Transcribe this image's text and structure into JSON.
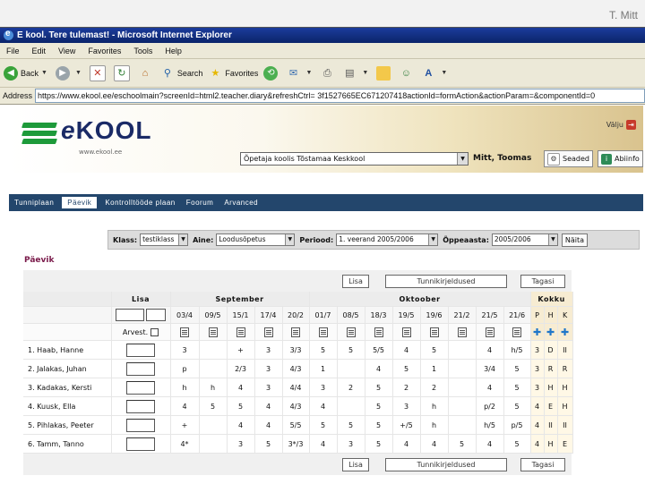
{
  "slide": {
    "author": "T. Mitt"
  },
  "window": {
    "title": "E kool. Tere tulemast! - Microsoft Internet Explorer"
  },
  "menu": [
    "File",
    "Edit",
    "View",
    "Favorites",
    "Tools",
    "Help"
  ],
  "toolbar": {
    "back": "Back",
    "search": "Search",
    "favorites": "Favorites"
  },
  "address": {
    "label": "Address",
    "url": "https://www.ekool.ee/eschoolmain?screenId=html2.teacher.diary&refreshCtrl= 3f1527665EC671207418actionId=formAction&actionParam=&componentId=0"
  },
  "header": {
    "logo_text_e": "e",
    "logo_text_rest": "KOOL",
    "logo_sub": "www.ekool.ee",
    "logout": "Välju",
    "school_select": "Õpetaja koolis Tõstamaa Keskkool",
    "user": "Mitt, Toomas",
    "settings_btn": "Seaded",
    "help_btn": "Abiinfo"
  },
  "nav": [
    "Tunniplaan",
    "Päevik",
    "Kontrolltööde plaan",
    "Foorum",
    "Arvanced"
  ],
  "nav_active": "Päevik",
  "filters": {
    "klass_label": "Klass:",
    "klass_value": "testiklass",
    "aine_label": "Aine:",
    "aine_value": "Loodusõpetus",
    "periood_label": "Periood:",
    "periood_value": "1. veerand 2005/2006",
    "oppeaasta_label": "Õppeaasta:",
    "oppeaasta_value": "2005/2006",
    "show_btn": "Näita"
  },
  "section_title": "Päevik",
  "grid": {
    "btn_lisa": "Lisa",
    "btn_tunnikirjeldused": "Tunnikirjeldused",
    "btn_tagasi": "Tagasi",
    "hdr_lisa": "Lisa",
    "hdr_september": "September",
    "hdr_oktoober": "Oktoober",
    "hdr_kokku": "Kokku",
    "dates": [
      "03/4",
      "09/5",
      "15/1",
      "17/4",
      "20/2",
      "01/7",
      "08/5",
      "18/3",
      "19/5",
      "19/6",
      "21/2",
      "21/5",
      "21/6"
    ],
    "kokku_cols": [
      "P",
      "H",
      "K"
    ],
    "arvest_label": "Arvest.",
    "students": [
      {
        "name": "1. Haab, Hanne",
        "marks": [
          "3",
          "",
          "+",
          "3",
          "3/3",
          "5",
          "5",
          "5/5",
          "4",
          "5",
          "",
          "4",
          "h/5"
        ],
        "kokku": [
          "3",
          "D",
          "II"
        ]
      },
      {
        "name": "2. Jalakas, Juhan",
        "marks": [
          "p",
          "",
          "2/3",
          "3",
          "4/3",
          "1",
          "",
          "4",
          "5",
          "1",
          "",
          "3/4",
          "5"
        ],
        "kokku": [
          "3",
          "R",
          "R"
        ]
      },
      {
        "name": "3. Kadakas, Kersti",
        "marks": [
          "h",
          "h",
          "4",
          "3",
          "4/4",
          "3",
          "2",
          "5",
          "2",
          "2",
          "",
          "4",
          "5"
        ],
        "kokku": [
          "3",
          "H",
          "H"
        ]
      },
      {
        "name": "4. Kuusk, Ella",
        "marks": [
          "4",
          "5",
          "5",
          "4",
          "4/3",
          "4",
          "",
          "5",
          "3",
          "h",
          "",
          "p/2",
          "5"
        ],
        "kokku": [
          "4",
          "E",
          "H"
        ]
      },
      {
        "name": "5. Pihlakas, Peeter",
        "marks": [
          "+",
          "",
          "4",
          "4",
          "5/5",
          "5",
          "5",
          "5",
          "+/5",
          "h",
          "",
          "h/5",
          "p/5"
        ],
        "kokku": [
          "4",
          "II",
          "II"
        ]
      },
      {
        "name": "6. Tamm, Tanno",
        "marks": [
          "4*",
          "",
          "3",
          "5",
          "3*/3",
          "4",
          "3",
          "5",
          "4",
          "4",
          "5",
          "4",
          "5"
        ],
        "kokku": [
          "4",
          "H",
          "E"
        ]
      }
    ]
  },
  "colors": {
    "nav_bg": "#23466c",
    "title_bar": "#0a246a",
    "logo_green": "#1d9a3a",
    "section_title": "#7a1a4a"
  }
}
